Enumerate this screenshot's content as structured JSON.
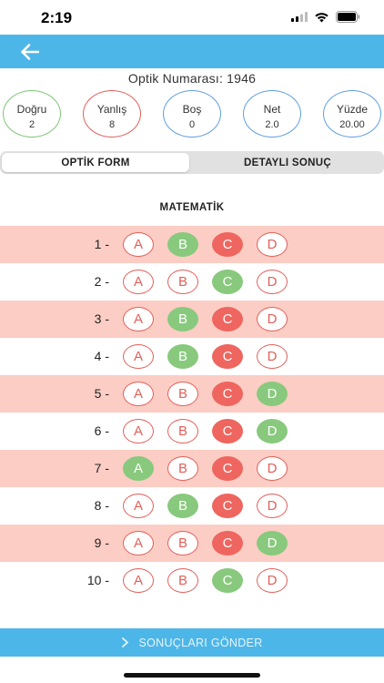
{
  "status_bar": {
    "time": "2:19"
  },
  "header": {
    "back_icon": "arrow-left-icon",
    "color": "#4db6e8"
  },
  "optik": {
    "title": "Optik Numarası: 1946"
  },
  "stats": [
    {
      "label": "Doğru",
      "value": "2",
      "color": "#7dc673"
    },
    {
      "label": "Yanlış",
      "value": "8",
      "color": "#e35f5a"
    },
    {
      "label": "Boş",
      "value": "0",
      "color": "#5f9ee0"
    },
    {
      "label": "Net",
      "value": "2.0",
      "color": "#5f9ee0"
    },
    {
      "label": "Yüzde",
      "value": "20.00",
      "color": "#5f9ee0"
    }
  ],
  "tabs": [
    {
      "label": "OPTİK FORM",
      "active": true
    },
    {
      "label": "DETAYLI SONUÇ",
      "active": false
    }
  ],
  "section": {
    "title": "MATEMATİK"
  },
  "options": [
    "A",
    "B",
    "C",
    "D"
  ],
  "questions": [
    {
      "label": "1 -",
      "correct": "B",
      "marked": "C"
    },
    {
      "label": "2 -",
      "correct": "C",
      "marked": null
    },
    {
      "label": "3 -",
      "correct": "B",
      "marked": "C"
    },
    {
      "label": "4 -",
      "correct": "B",
      "marked": "C"
    },
    {
      "label": "5 -",
      "correct": "D",
      "marked": "C"
    },
    {
      "label": "6 -",
      "correct": "D",
      "marked": "C"
    },
    {
      "label": "7 -",
      "correct": "A",
      "marked": "C"
    },
    {
      "label": "8 -",
      "correct": "B",
      "marked": "C"
    },
    {
      "label": "9 -",
      "correct": "D",
      "marked": "C"
    },
    {
      "label": "10 -",
      "correct": "C",
      "marked": null
    }
  ],
  "colors": {
    "correct": "#88c97d",
    "wrong": "#ee665f",
    "row_shade": "#fbcdc4",
    "accent": "#4db6e8"
  },
  "submit": {
    "label": "SONUÇLARI GÖNDER",
    "icon": "chevron-right-icon"
  }
}
